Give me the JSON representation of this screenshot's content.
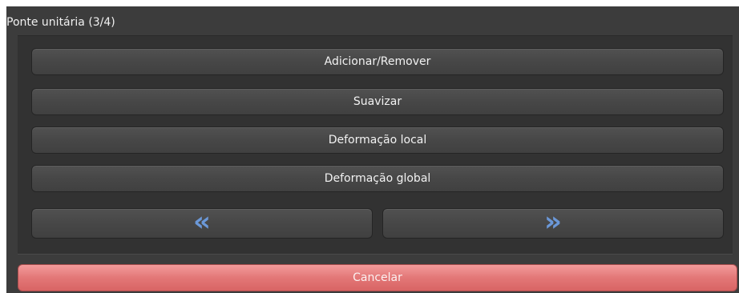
{
  "panel": {
    "title": "Ponte unitária (3/4)"
  },
  "buttons": {
    "add_remove": "Adicionar/Remover",
    "smooth": "Suavizar",
    "local_deform": "Deformação local",
    "global_deform": "Deformação global",
    "prev_glyph": "«",
    "next_glyph": "»",
    "cancel": "Cancelar"
  },
  "colors": {
    "panel_bg": "#3c3c3c",
    "arrow": "#6b98d8",
    "cancel_bg": "#e37777"
  },
  "icons": {
    "prev": "double-chevron-left-icon",
    "next": "double-chevron-right-icon"
  }
}
